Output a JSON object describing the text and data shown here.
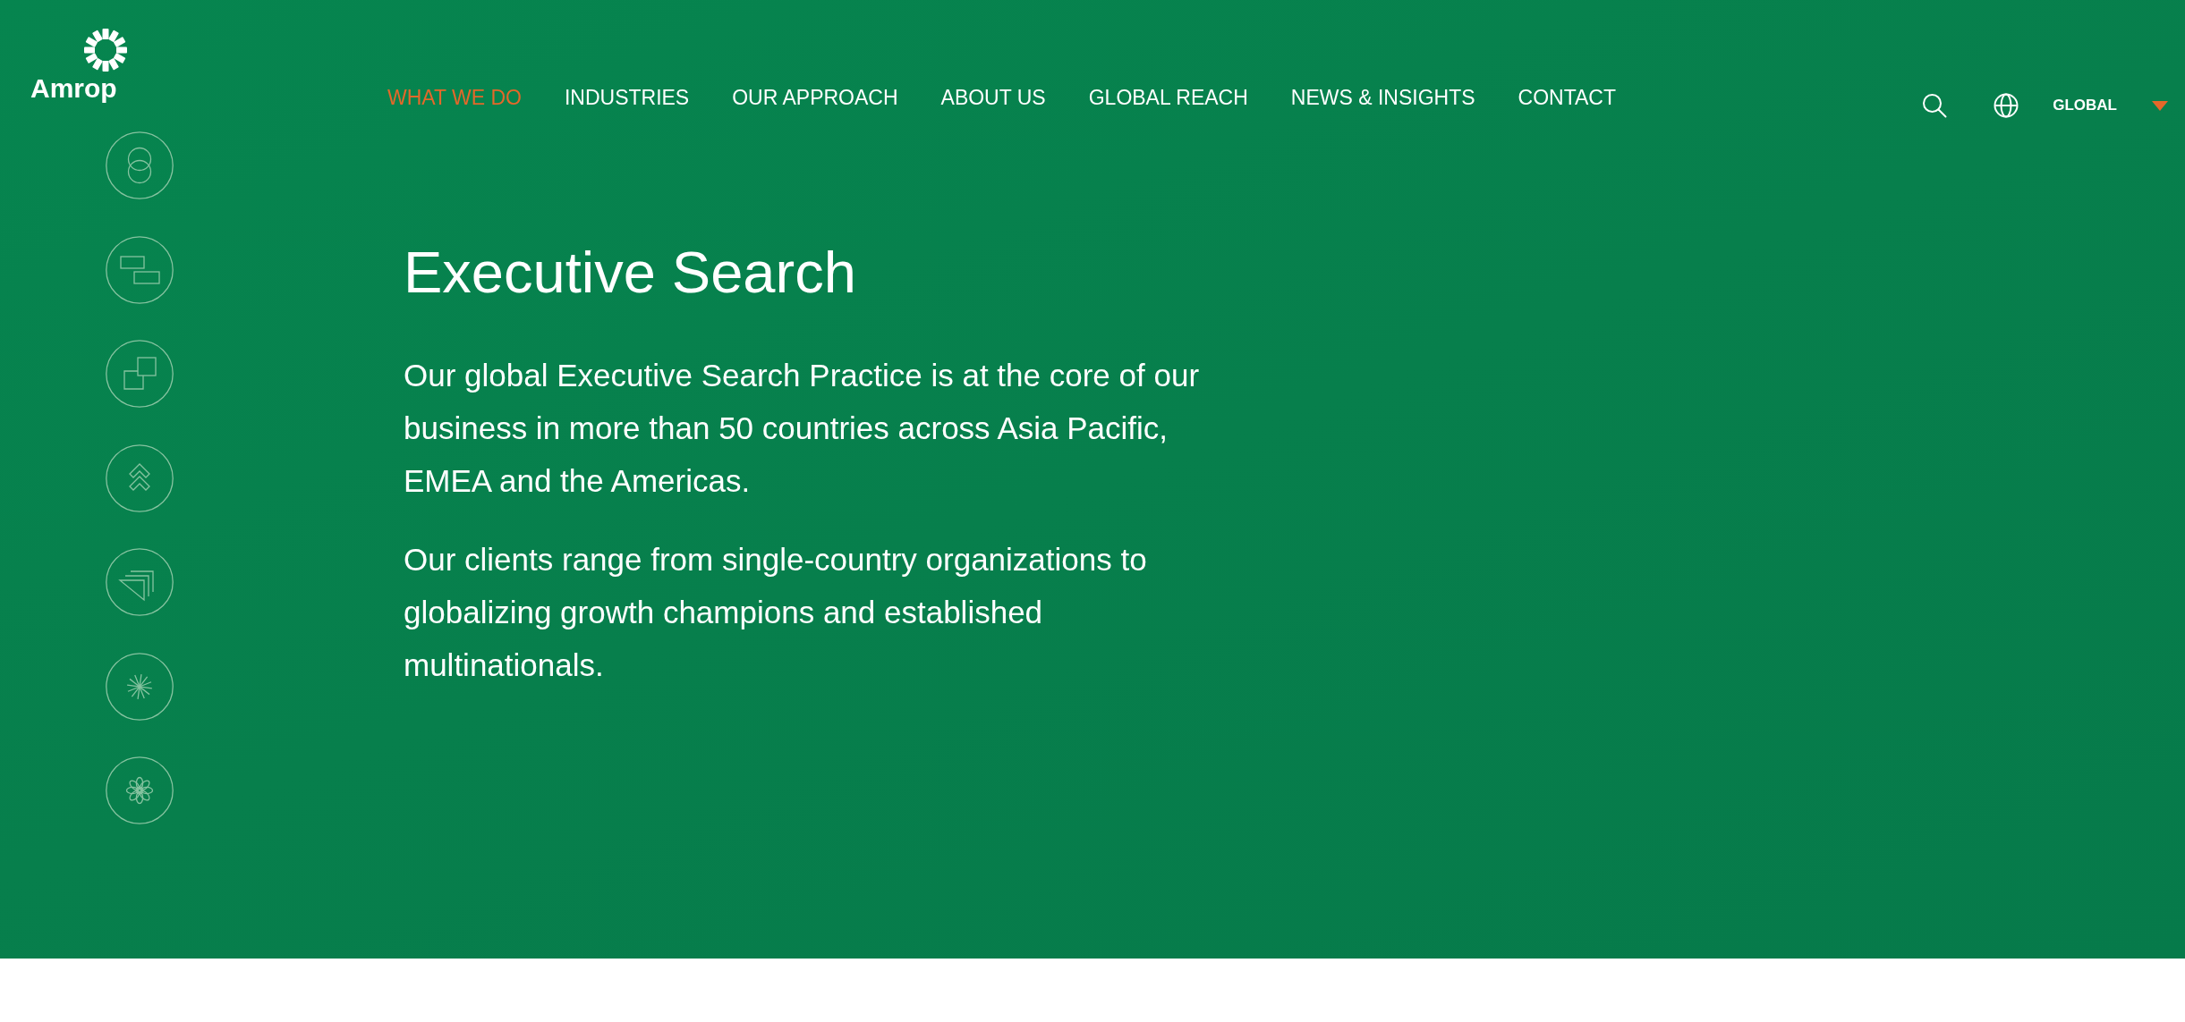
{
  "header": {
    "logo": {
      "wordmark": "Amrop"
    },
    "nav": [
      {
        "label": "WHAT WE DO",
        "selected": true
      },
      {
        "label": "INDUSTRIES",
        "selected": false
      },
      {
        "label": "OUR APPROACH",
        "selected": false
      },
      {
        "label": "ABOUT US",
        "selected": false
      },
      {
        "label": "GLOBAL REACH",
        "selected": false
      },
      {
        "label": "NEWS & INSIGHTS",
        "selected": false
      },
      {
        "label": "CONTACT",
        "selected": false
      }
    ],
    "region_selector": {
      "label": "GLOBAL"
    }
  },
  "hero": {
    "title": "Executive Search",
    "paragraphs": [
      "Our global Executive Search Practice is at the core of our business in more than 50 countries across Asia Pacific, EMEA and the Americas.",
      "Our clients range from single-country organizations to globalizing growth champions and established multinationals."
    ]
  }
}
